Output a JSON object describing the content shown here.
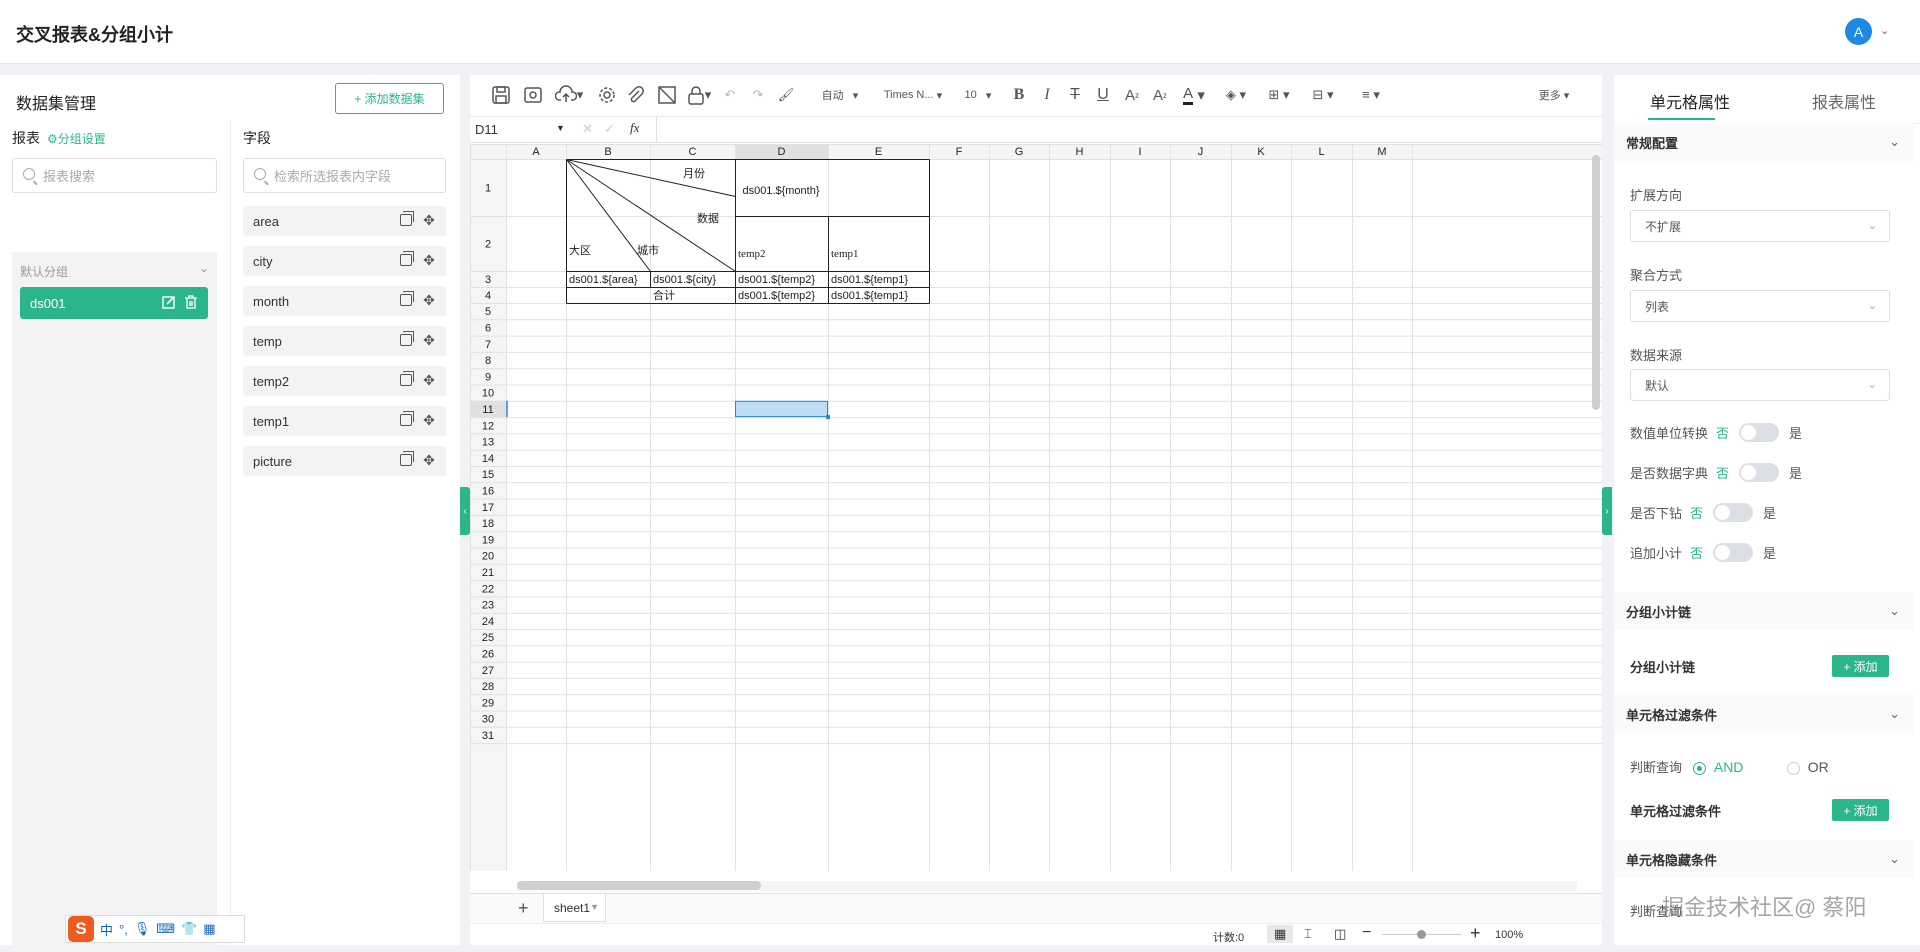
{
  "header": {
    "title": "交叉报表&分组小计",
    "avatar_letter": "A"
  },
  "left": {
    "title": "数据集管理",
    "add_button": "+ 添加数据集",
    "reports_label": "报表",
    "group_settings": "分组设置",
    "report_search_placeholder": "报表搜索",
    "default_group": "默认分组",
    "dataset": "ds001",
    "fields_label": "字段",
    "field_search_placeholder": "检索所选报表内字段",
    "fields": [
      "area",
      "city",
      "month",
      "temp",
      "temp2",
      "temp1",
      "picture"
    ]
  },
  "toolbar": {
    "font_auto": "自动",
    "font_name": "Times N...",
    "font_size": "10",
    "more": "更多"
  },
  "formula": {
    "cell_ref": "D11",
    "fx": "fx"
  },
  "grid": {
    "columns": [
      "A",
      "B",
      "C",
      "D",
      "E",
      "F",
      "G",
      "H",
      "I",
      "J",
      "K",
      "L",
      "M"
    ],
    "rows": [
      "1",
      "2",
      "3",
      "4",
      "5",
      "6",
      "7",
      "8",
      "9",
      "10",
      "11",
      "12",
      "13",
      "14",
      "15",
      "16",
      "17",
      "18",
      "19",
      "20",
      "21",
      "22",
      "23",
      "24",
      "25",
      "26",
      "27",
      "28",
      "29",
      "30",
      "31"
    ],
    "cells": {
      "b1_month": "月份",
      "b1_data": "数据",
      "b2_region": "大区",
      "b2_city": "城市",
      "d1": "ds001.${month}",
      "d2": "temp2",
      "e2": "temp1",
      "b3": "ds001.${area}",
      "c3": "ds001.${city}",
      "d3": "ds001.${temp2}",
      "e3": "ds001.${temp1}",
      "c4": "合计",
      "d4": "ds001.${temp2}",
      "e4": "ds001.${temp1}"
    }
  },
  "sheet_tab": "sheet1",
  "status": {
    "count": "计数:0",
    "zoom": "100%"
  },
  "right": {
    "tab_cell": "单元格属性",
    "tab_report": "报表属性",
    "sec_general": "常规配置",
    "expand_label": "扩展方向",
    "expand_value": "不扩展",
    "agg_label": "聚合方式",
    "agg_value": "列表",
    "source_label": "数据来源",
    "source_value": "默认",
    "toggles": [
      {
        "label": "数值单位转换",
        "no": "否",
        "yes": "是"
      },
      {
        "label": "是否数据字典",
        "no": "否",
        "yes": "是"
      },
      {
        "label": "是否下钻",
        "no": "否",
        "yes": "是"
      },
      {
        "label": "追加小计",
        "no": "否",
        "yes": "是"
      }
    ],
    "sec_subtotal": "分组小计链",
    "subtotal_label": "分组小计链",
    "add": "+ 添加",
    "sec_filter": "单元格过滤条件",
    "judge_label": "判断查询",
    "and": "AND",
    "or": "OR",
    "filter_label": "单元格过滤条件",
    "sec_hide": "单元格隐藏条件",
    "judge_label2": "判断查询"
  },
  "watermark": "掘金技术社区@ 蔡阳",
  "ime": {
    "logo": "S",
    "lang": "中"
  },
  "colors": {
    "accent": "#2bb58b",
    "selection": "#bfdcf7"
  }
}
